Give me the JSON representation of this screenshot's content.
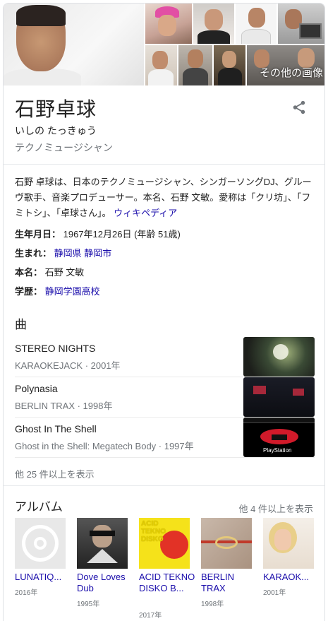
{
  "header": {
    "more_images_label": "その他の画像"
  },
  "entity": {
    "name": "石野卓球",
    "reading": "いしの たっきゅう",
    "subtitle": "テクノミュージシャン"
  },
  "description": {
    "text": "石野 卓球は、日本のテクノミュージシャン、シンガーソングDJ、グルーヴ歌手、音楽プロデューサー。本名、石野 文敏。愛称は「クリ坊」、「フミトシ」、「卓球さん」。",
    "source_link": "ウィキペディア"
  },
  "facts": [
    {
      "label": "生年月日：",
      "value": "1967年12月26日 (年齢 51歳)",
      "links": []
    },
    {
      "label": "生まれ：",
      "value": "",
      "links": [
        "静岡県",
        "静岡市"
      ]
    },
    {
      "label": "本名：",
      "value": "石野 文敏",
      "links": []
    },
    {
      "label": "学歴：",
      "value": "",
      "links": [
        "静岡学園高校"
      ]
    }
  ],
  "songs": {
    "heading": "曲",
    "items": [
      {
        "title": "STEREO NIGHTS",
        "meta": "KARAOKEJACK · 2001年"
      },
      {
        "title": "Polynasia",
        "meta": "BERLIN TRAX · 1998年"
      },
      {
        "title": "Ghost In The Shell",
        "meta": "Ghost in the Shell: Megatech Body · 1997年"
      }
    ],
    "more_label": "他 25 件以上を表示"
  },
  "albums": {
    "heading": "アルバム",
    "more_label": "他 4 件以上を表示",
    "items": [
      {
        "title": "LUNATIQ...",
        "year": "2016年"
      },
      {
        "title": "Dove Loves Dub",
        "year": "1995年"
      },
      {
        "title": "ACID TEKNO DISKO B...",
        "year": "2017年"
      },
      {
        "title": "BERLIN TRAX",
        "year": "1998年"
      },
      {
        "title": "KARAOK...",
        "year": "2001年"
      }
    ],
    "acid_cover_text": "ACID TEKNO DISKO",
    "playstation_label": "PlayStation"
  },
  "colors": {
    "link": "#1a0dab",
    "muted": "#70757a",
    "divider": "#e8eaed"
  }
}
